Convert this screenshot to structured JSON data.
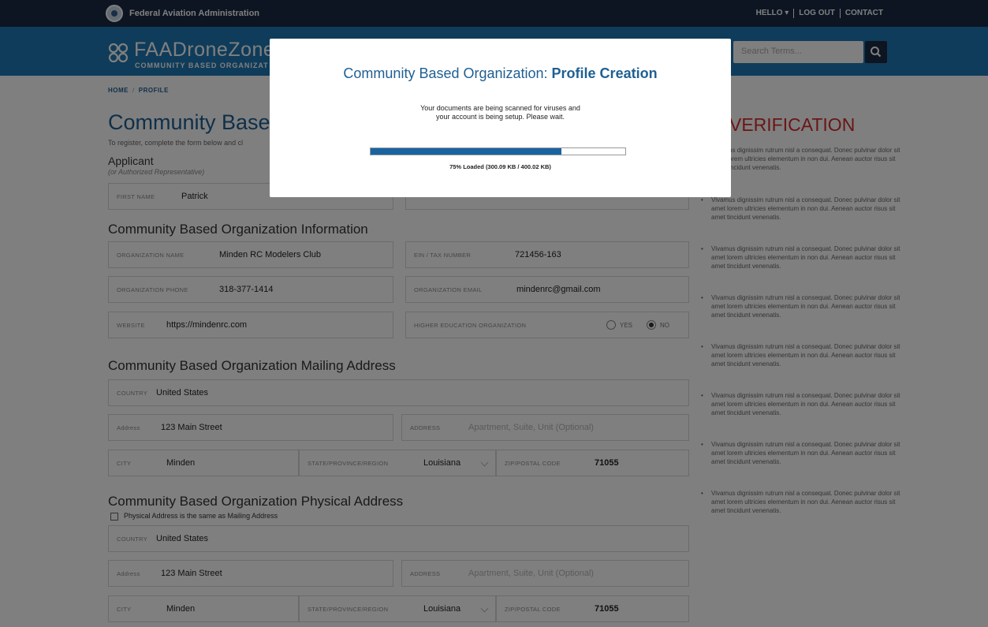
{
  "topbar": {
    "agency": "Federal Aviation Administration",
    "hello": "HELLO ▾",
    "logout": "LOG OUT",
    "contact": "CONTACT"
  },
  "header": {
    "logo_title": "FAADroneZone",
    "logo_sub": "COMMUNITY BASED ORGANIZAT",
    "search_placeholder": "Search Terms..."
  },
  "breadcrumb": {
    "home": "HOME",
    "sep": "/",
    "current": "PROFILE"
  },
  "page": {
    "title": "Community Based",
    "intro": "To register, complete the form below and cl"
  },
  "applicant": {
    "heading": "Applicant",
    "sub": "(or Authorized Representative)",
    "first_name_label": "FIRST NAME",
    "first_name_value": "Patrick"
  },
  "org_info": {
    "heading": "Community Based Organization Information",
    "name_label": "ORGANIZATION NAME",
    "name_value": "Minden RC Modelers Club",
    "ein_label": "EIN / TAX NUMBER",
    "ein_value": "721456-163",
    "phone_label": "ORGANIZATION PHONE",
    "phone_value": "318-377-1414",
    "email_label": "ORGANIZATION EMAIL",
    "email_value": "mindenrc@gmail.com",
    "website_label": "WEBSITE",
    "website_value": "https://mindenrc.com",
    "higher_ed_label": "HIGHER EDUCATION ORGANIZATION",
    "yes_label": "YES",
    "no_label": "NO",
    "higher_ed_selected": "NO"
  },
  "mailing": {
    "heading": "Community Based Organization Mailing Address",
    "country_label": "COUNTRY",
    "country_value": "United States",
    "address_label": "Address",
    "address_value": "123 Main Street",
    "address2_label": "ADDRESS",
    "address2_placeholder": "Apartment, Suite, Unit (Optional)",
    "city_label": "CITY",
    "city_value": "Minden",
    "state_label": "STATE/PROVINCE/REGION",
    "state_value": "Louisiana",
    "zip_label": "ZIP/POSTAL CODE",
    "zip_value": "71055"
  },
  "physical": {
    "heading": "Community Based Organization Physical Address",
    "same_checkbox_label": "Physical Address is the same as Mailing Address",
    "same_checked": false,
    "country_label": "COUNTRY",
    "country_value": "United States",
    "address_label": "Address",
    "address_value": "123 Main Street",
    "address2_label": "ADDRESS",
    "address2_placeholder": "Apartment, Suite, Unit (Optional)",
    "city_label": "CITY",
    "city_value": "Minden",
    "state_label": "STATE/PROVINCE/REGION",
    "state_value": "Louisiana",
    "zip_label": "ZIP/POSTAL CODE",
    "zip_value": "71055"
  },
  "sidebar": {
    "title": "D VERIFICATION",
    "items": [
      "Vivamus dignissim rutrum nisl a consequat. Donec pulvinar dolor sit amet lorem ultricies elementum in non dui. Aenean auctor risus sit amet tincidunt venenatis.",
      "Vivamus dignissim rutrum nisl a consequat. Donec pulvinar dolor sit amet lorem ultricies elementum in non dui. Aenean auctor risus sit amet tincidunt venenatis.",
      "Vivamus dignissim rutrum nisl a consequat. Donec pulvinar dolor sit amet lorem ultricies elementum in non dui. Aenean auctor risus sit amet tincidunt venenatis.",
      "Vivamus dignissim rutrum nisl a consequat. Donec pulvinar dolor sit amet lorem ultricies elementum in non dui. Aenean auctor risus sit amet tincidunt venenatis.",
      "Vivamus dignissim rutrum nisl a consequat. Donec pulvinar dolor sit amet lorem ultricies elementum in non dui. Aenean auctor risus sit amet tincidunt venenatis.",
      "Vivamus dignissim rutrum nisl a consequat. Donec pulvinar dolor sit amet lorem ultricies elementum in non dui. Aenean auctor risus sit amet tincidunt venenatis.",
      "Vivamus dignissim rutrum nisl a consequat. Donec pulvinar dolor sit amet lorem ultricies elementum in non dui. Aenean auctor risus sit amet tincidunt venenatis.",
      "Vivamus dignissim rutrum nisl a consequat. Donec pulvinar dolor sit amet lorem ultricies elementum in non dui. Aenean auctor risus sit amet tincidunt venenatis."
    ]
  },
  "modal": {
    "title_prefix": "Community Based Organization: ",
    "title_bold": "Profile Creation",
    "message_line1": "Your documents are being scanned for viruses and",
    "message_line2": "your account is being setup. Please wait.",
    "progress_fraction": 0.75,
    "progress_label": "75% Loaded (300.09 KB / 400.02 KB)"
  },
  "colors": {
    "topbar": "#1b2a44",
    "header": "#1f78b4",
    "brand_text": "#1f5f93",
    "sidebar_title": "#d62b2b",
    "progress_fill": "#1a63a1"
  }
}
